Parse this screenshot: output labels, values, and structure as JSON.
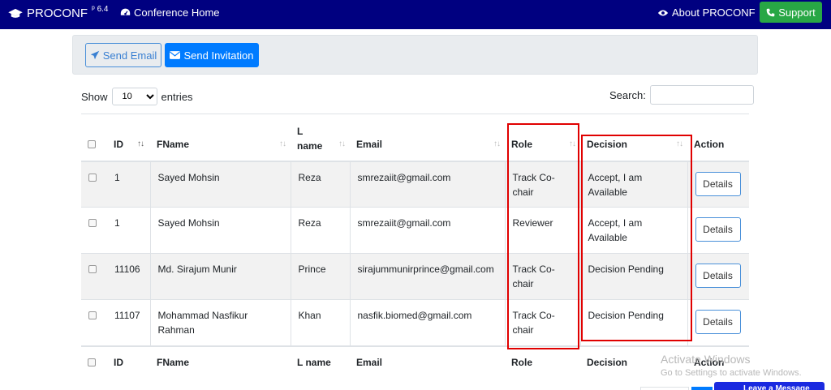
{
  "navbar": {
    "brand": "PROCONF",
    "version": "6.4",
    "home": "Conference Home",
    "about": "About PROCONF",
    "support": "Support"
  },
  "actions": {
    "send_email": "Send Email",
    "send_invitation": "Send Invitation"
  },
  "entries": {
    "show_label": "Show",
    "value": "10",
    "suffix": "entries"
  },
  "search": {
    "label": "Search:"
  },
  "table": {
    "headers": [
      "ID",
      "FName",
      "L name",
      "Email",
      "Role",
      "Decision",
      "Action"
    ],
    "rows": [
      {
        "id": "1",
        "fname": "Sayed Mohsin",
        "lname": "Reza",
        "email": "smrezaiit@gmail.com",
        "role": "Track Co-chair",
        "decision": "Accept, I am Available",
        "action": "Details"
      },
      {
        "id": "1",
        "fname": "Sayed Mohsin",
        "lname": "Reza",
        "email": "smrezaiit@gmail.com",
        "role": "Reviewer",
        "decision": "Accept, I am Available",
        "action": "Details"
      },
      {
        "id": "11106",
        "fname": "Md. Sirajum Munir",
        "lname": "Prince",
        "email": "sirajummunirprince@gmail.com",
        "role": "Track Co-chair",
        "decision": "Decision Pending",
        "action": "Details"
      },
      {
        "id": "11107",
        "fname": "Mohammad Nasfikur Rahman",
        "lname": "Khan",
        "email": "nasfik.biomed@gmail.com",
        "role": "Track Co-chair",
        "decision": "Decision Pending",
        "action": "Details"
      }
    ]
  },
  "watermark": {
    "line1": "Activate Windows",
    "line2": "Go to Settings to activate Windows."
  },
  "chat": {
    "label": "Leave a Message"
  },
  "colors": {
    "navbar": "#000080",
    "support": "#28a745",
    "primary": "#007bff",
    "highlight": "#e00000"
  }
}
